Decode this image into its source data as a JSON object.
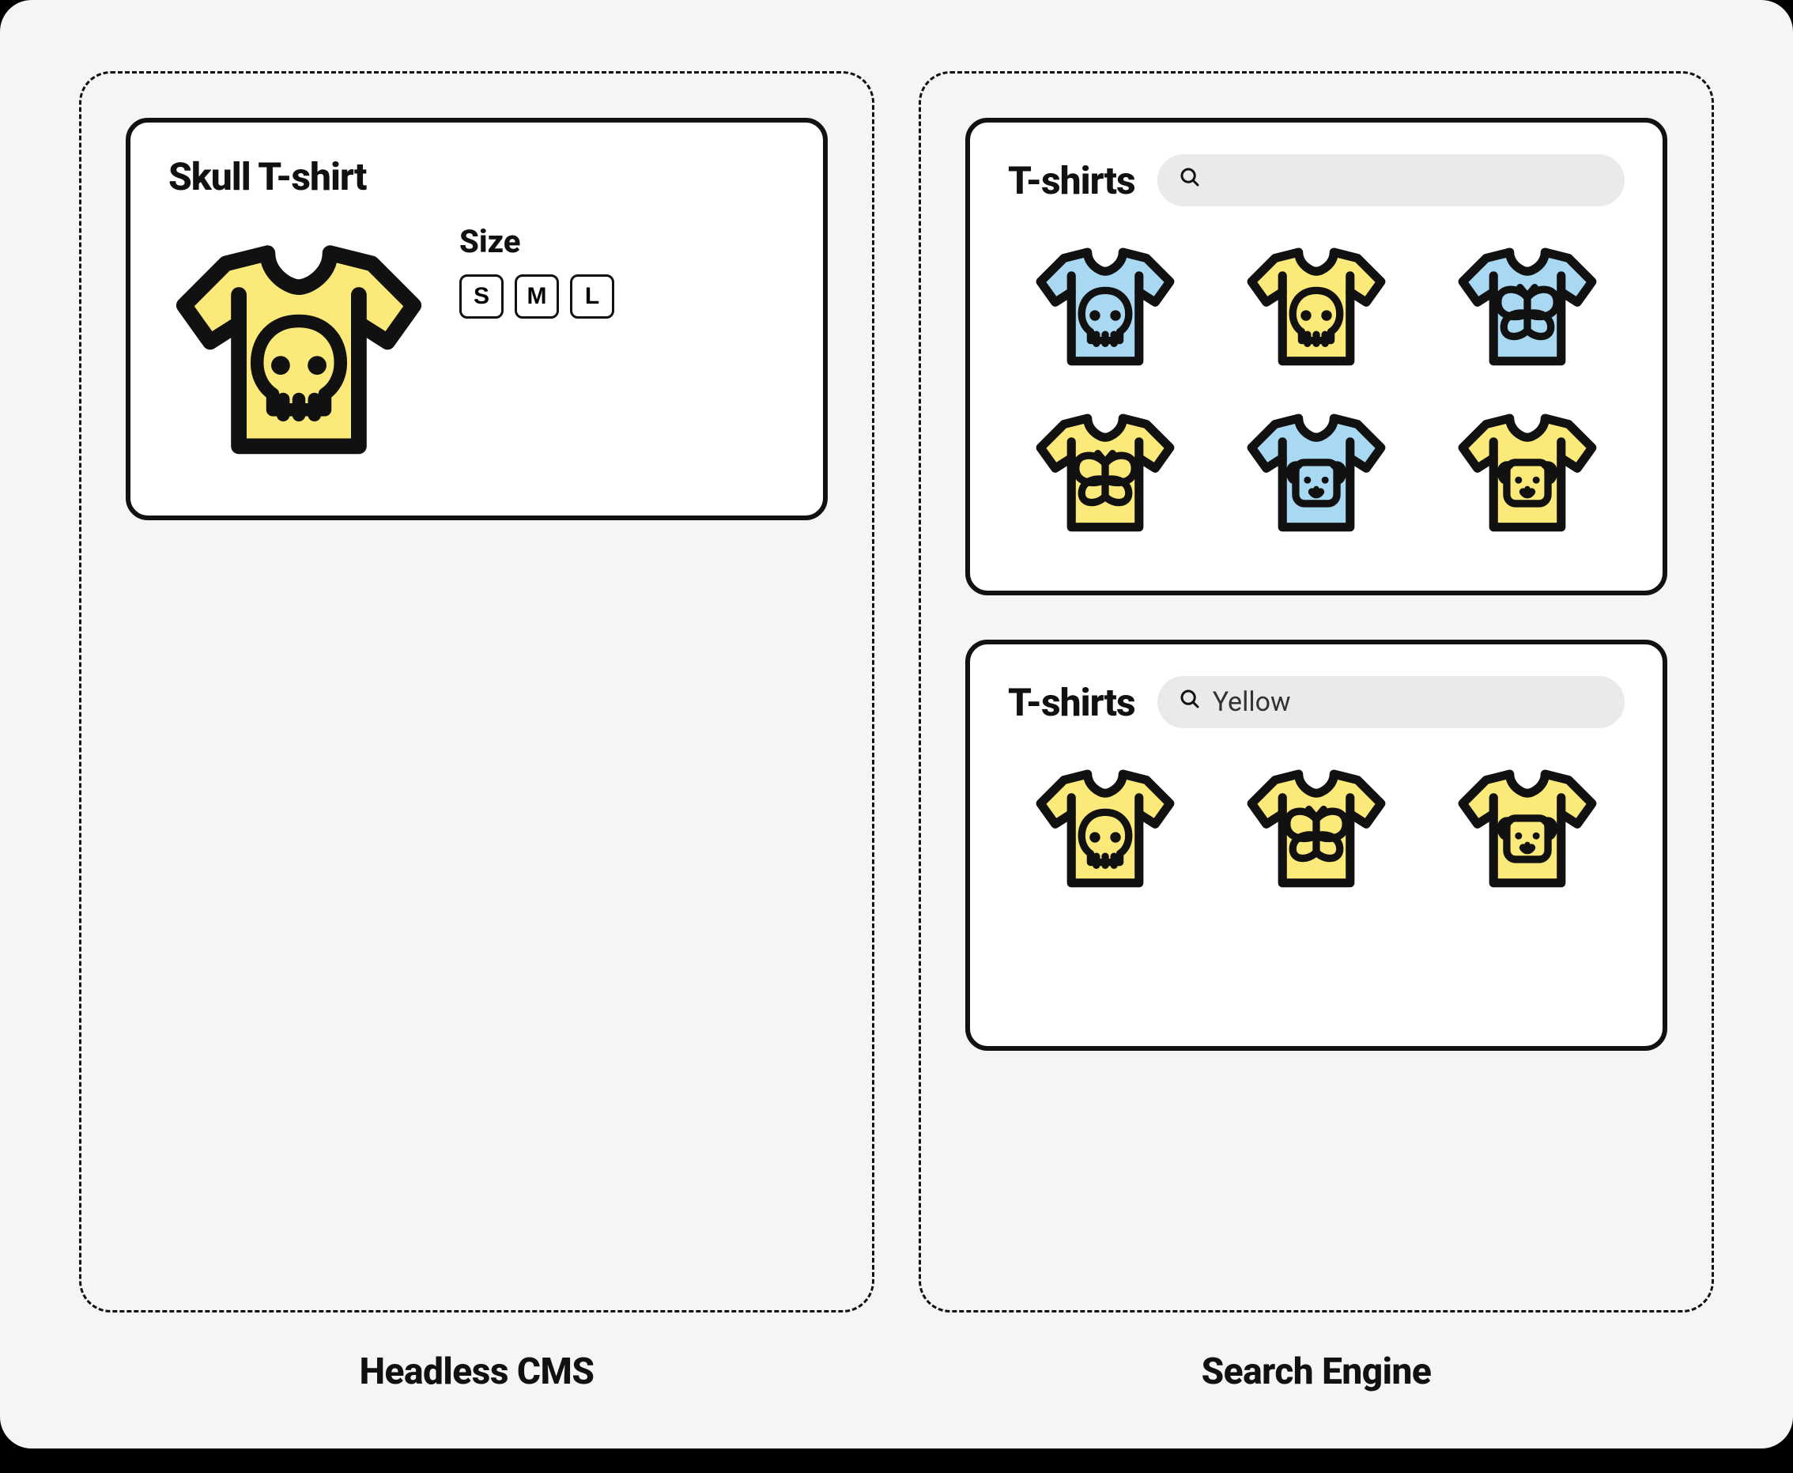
{
  "left": {
    "label": "Headless CMS",
    "card": {
      "title": "Skull T-shirt",
      "size_label": "Size",
      "sizes": [
        "S",
        "M",
        "L"
      ],
      "shirt": {
        "color": "yellow",
        "motif": "skull"
      }
    }
  },
  "right": {
    "label": "Search Engine",
    "card_all": {
      "title": "T-shirts",
      "search_value": "",
      "items": [
        {
          "color": "blue",
          "motif": "skull"
        },
        {
          "color": "yellow",
          "motif": "skull"
        },
        {
          "color": "blue",
          "motif": "butterfly"
        },
        {
          "color": "yellow",
          "motif": "butterfly"
        },
        {
          "color": "blue",
          "motif": "dog"
        },
        {
          "color": "yellow",
          "motif": "dog"
        }
      ]
    },
    "card_filtered": {
      "title": "T-shirts",
      "search_value": "Yellow",
      "items": [
        {
          "color": "yellow",
          "motif": "skull"
        },
        {
          "color": "yellow",
          "motif": "butterfly"
        },
        {
          "color": "yellow",
          "motif": "dog"
        }
      ]
    }
  },
  "palette": {
    "yellow": "#fbe97a",
    "blue": "#a9d8f3",
    "stroke": "#111111",
    "search_bg": "#eaeaea"
  }
}
